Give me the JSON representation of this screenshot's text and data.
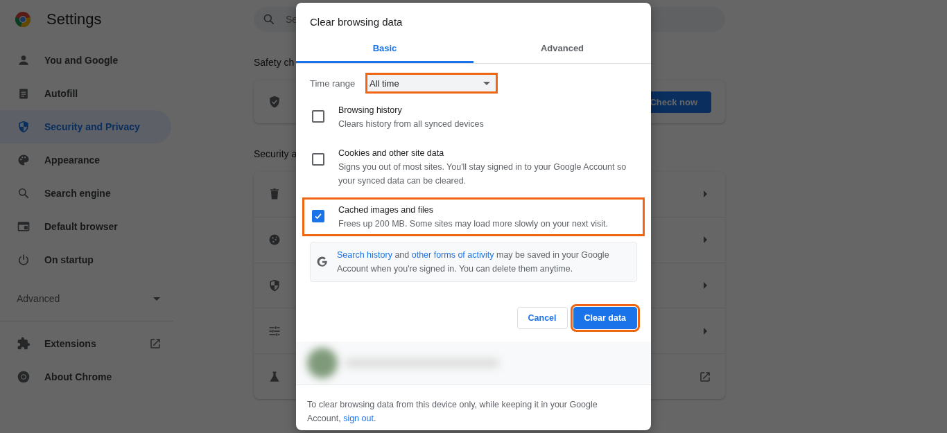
{
  "sidebar": {
    "title": "Settings",
    "items": [
      {
        "label": "You and Google",
        "kind": "person",
        "selected": false
      },
      {
        "label": "Autofill",
        "kind": "clipboard",
        "selected": false
      },
      {
        "label": "Security and Privacy",
        "kind": "shield",
        "selected": true
      },
      {
        "label": "Appearance",
        "kind": "palette",
        "selected": false
      },
      {
        "label": "Search engine",
        "kind": "search",
        "selected": false
      },
      {
        "label": "Default browser",
        "kind": "browser",
        "selected": false
      },
      {
        "label": "On startup",
        "kind": "power",
        "selected": false
      }
    ],
    "advanced": {
      "label": "Advanced",
      "expanded": false
    },
    "links": [
      {
        "label": "Extensions",
        "kind": "puzzle",
        "external": true
      },
      {
        "label": "About Chrome",
        "kind": "chrome",
        "external": false
      }
    ]
  },
  "main": {
    "search": {
      "placeholder": "Se"
    },
    "safety": {
      "heading": "Safety ch",
      "button": "Check now"
    },
    "security": {
      "heading": "Security a",
      "rows": [
        {
          "kind": "trash",
          "external": false
        },
        {
          "kind": "cookie",
          "external": false
        },
        {
          "kind": "shield",
          "external": false
        },
        {
          "kind": "sliders",
          "external": false
        },
        {
          "kind": "flask",
          "external": true
        }
      ]
    }
  },
  "dialog": {
    "title": "Clear browsing data",
    "tabs": [
      {
        "label": "Basic",
        "selected": true
      },
      {
        "label": "Advanced",
        "selected": false
      }
    ],
    "time_range": {
      "label": "Time range",
      "value": "All time",
      "highlighted": true
    },
    "options": [
      {
        "title": "Browsing history",
        "description": "Clears history from all synced devices",
        "checked": false,
        "highlighted": false
      },
      {
        "title": "Cookies and other site data",
        "description": "Signs you out of most sites. You'll stay signed in to your Google Account so your synced data can be cleared.",
        "checked": false,
        "highlighted": false
      },
      {
        "title": "Cached images and files",
        "description": "Frees up 200 MB. Some sites may load more slowly on your next visit.",
        "checked": true,
        "highlighted": true
      }
    ],
    "notice": {
      "link_1": "Search history",
      "text_1": " and ",
      "link_2": "other forms of activity",
      "text_2": " may be saved in your Google Account when you're signed in. You can delete them anytime."
    },
    "buttons": {
      "cancel": {
        "label": "Cancel",
        "highlighted": false
      },
      "confirm": {
        "label": "Clear data",
        "highlighted": true
      }
    },
    "footer": {
      "text": "To clear browsing data from this device only, while keeping it in your Google Account, ",
      "link": "sign out",
      "end": "."
    }
  }
}
